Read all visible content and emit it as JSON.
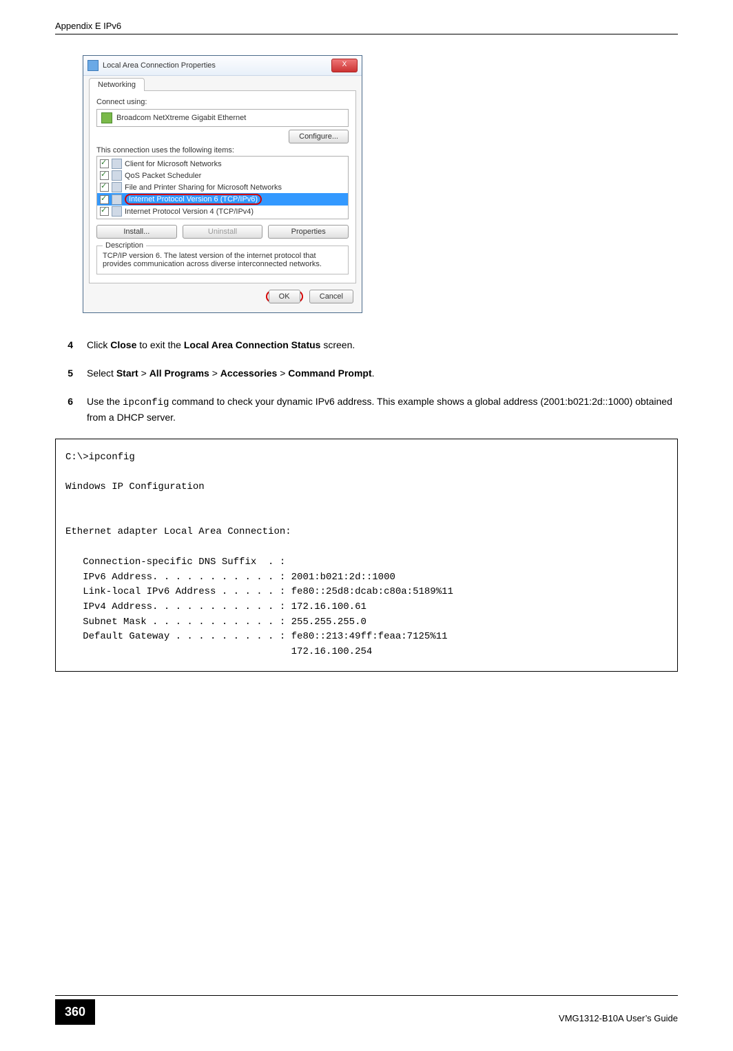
{
  "header": {
    "left": "Appendix E IPv6"
  },
  "dialog": {
    "title": "Local Area Connection Properties",
    "close_x": "X",
    "tab": "Networking",
    "connect_using": "Connect using:",
    "adapter": "Broadcom NetXtreme Gigabit Ethernet",
    "configure": "Configure...",
    "uses_items": "This connection uses the following items:",
    "items": [
      "Client for Microsoft Networks",
      "QoS Packet Scheduler",
      "File and Printer Sharing for Microsoft Networks",
      "Internet Protocol Version 6 (TCP/IPv6)",
      "Internet Protocol Version 4 (TCP/IPv4)"
    ],
    "install": "Install...",
    "uninstall": "Uninstall",
    "properties": "Properties",
    "desc_legend": "Description",
    "desc_text": "TCP/IP version 6. The latest version of the internet protocol that provides communication across diverse interconnected networks.",
    "ok": "OK",
    "cancel": "Cancel"
  },
  "steps": {
    "s4": {
      "num": "4",
      "t1": "Click ",
      "b1": "Close",
      "t2": " to exit the ",
      "b2": "Local Area Connection Status",
      "t3": " screen."
    },
    "s5": {
      "num": "5",
      "t1": "Select ",
      "b1": "Start",
      "t2": " > ",
      "b2": "All Programs",
      "t3": " > ",
      "b3": "Accessories",
      "t4": " > ",
      "b4": "Command Prompt",
      "t5": "."
    },
    "s6": {
      "num": "6",
      "t1": "Use the ",
      "mono": "ipconfig",
      "t2": " command to check your dynamic IPv6 address. This example shows a global address (2001:b021:2d::1000) obtained from a DHCP server."
    }
  },
  "code": "C:\\>ipconfig\n\nWindows IP Configuration\n\n\nEthernet adapter Local Area Connection:\n\n   Connection-specific DNS Suffix  . : \n   IPv6 Address. . . . . . . . . . . : 2001:b021:2d::1000\n   Link-local IPv6 Address . . . . . : fe80::25d8:dcab:c80a:5189%11\n   IPv4 Address. . . . . . . . . . . : 172.16.100.61\n   Subnet Mask . . . . . . . . . . . : 255.255.255.0\n   Default Gateway . . . . . . . . . : fe80::213:49ff:feaa:7125%11\n                                       172.16.100.254",
  "footer": {
    "page": "360",
    "right": "VMG1312-B10A User’s Guide"
  }
}
